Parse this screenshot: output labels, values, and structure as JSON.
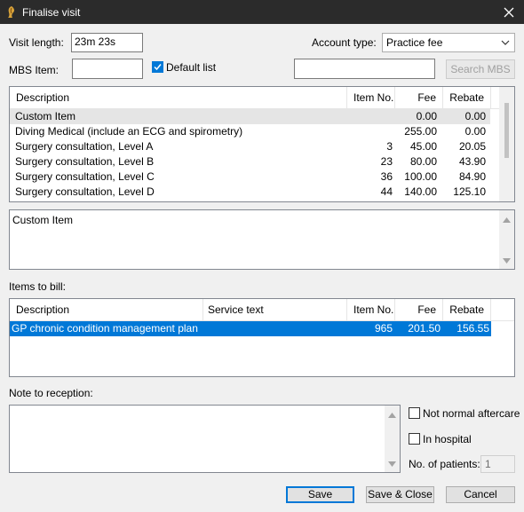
{
  "window": {
    "title": "Finalise visit"
  },
  "visit": {
    "length_label": "Visit length:",
    "length_value": "23m  23s",
    "account_type_label": "Account type:",
    "account_type_value": "Practice fee"
  },
  "mbs": {
    "item_label": "MBS Item:",
    "item_value": "",
    "default_list_label": "Default list",
    "default_list_checked": true,
    "search_value": "",
    "search_button": "Search MBS"
  },
  "items_table": {
    "columns": [
      "Description",
      "Item No.",
      "Fee",
      "Rebate"
    ],
    "rows": [
      {
        "description": "Custom Item",
        "item_no": "",
        "fee": "0.00",
        "rebate": "0.00"
      },
      {
        "description": "Diving Medical (include an ECG and spirometry)",
        "item_no": "",
        "fee": "255.00",
        "rebate": "0.00"
      },
      {
        "description": "Surgery consultation, Level A",
        "item_no": "3",
        "fee": "45.00",
        "rebate": "20.05"
      },
      {
        "description": "Surgery consultation, Level B",
        "item_no": "23",
        "fee": "80.00",
        "rebate": "43.90"
      },
      {
        "description": "Surgery consultation, Level C",
        "item_no": "36",
        "fee": "100.00",
        "rebate": "84.90"
      },
      {
        "description": "Surgery consultation, Level D",
        "item_no": "44",
        "fee": "140.00",
        "rebate": "125.10"
      }
    ]
  },
  "detail_text": "Custom Item",
  "bill": {
    "label": "Items to bill:",
    "columns": [
      "Description",
      "Service text",
      "Item No.",
      "Fee",
      "Rebate"
    ],
    "rows": [
      {
        "description": "GP chronic condition management plan",
        "service_text": "",
        "item_no": "965",
        "fee": "201.50",
        "rebate": "156.55"
      }
    ]
  },
  "reception": {
    "label": "Note to reception:",
    "note": ""
  },
  "options": {
    "not_normal_aftercare_label": "Not normal aftercare",
    "not_normal_aftercare_checked": false,
    "in_hospital_label": "In hospital",
    "in_hospital_checked": false,
    "patients_label": "No. of patients:",
    "patients_value": "1"
  },
  "buttons": {
    "save": "Save",
    "save_close": "Save & Close",
    "cancel": "Cancel"
  },
  "colors": {
    "titlebar": "#2b2b2b",
    "selection": "#0078d7",
    "highlight_row": "#e5e5e5",
    "window": "#f0f0f0"
  }
}
